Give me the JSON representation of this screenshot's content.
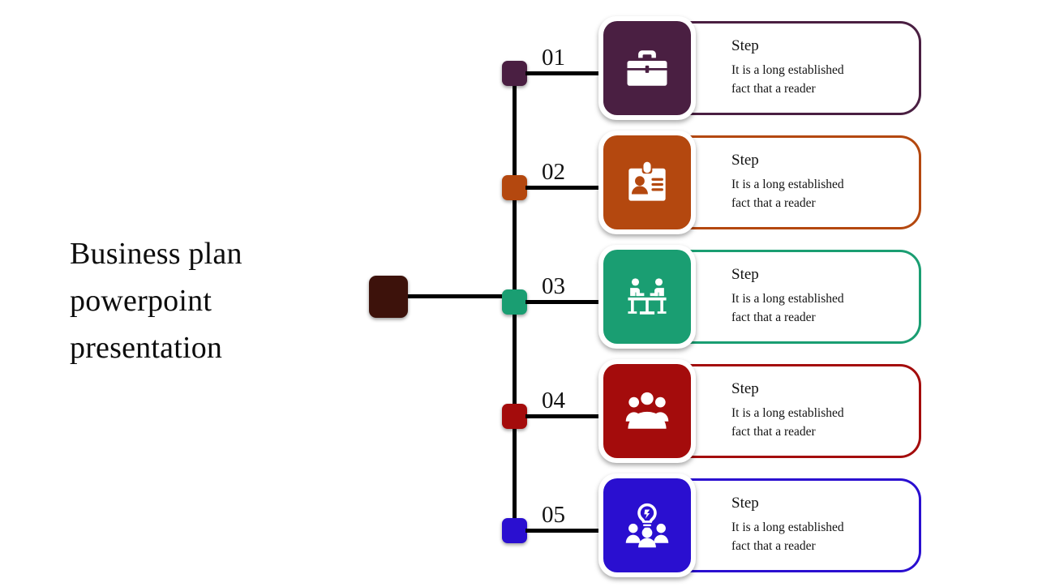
{
  "slide": {
    "title": "Business plan powerpoint presentation",
    "title_lines": [
      "Business plan",
      "powerpoint",
      "presentation"
    ],
    "background_color": "#ffffff",
    "anchor_color": "#3d120b",
    "spine_color": "#000000"
  },
  "steps": [
    {
      "number": "01",
      "title": "Step",
      "body_lines": [
        "It is a long established",
        "fact that a reader"
      ],
      "body": "It is a long established fact that a reader",
      "color": "#4a1f42",
      "icon": "briefcase-icon"
    },
    {
      "number": "02",
      "title": "Step",
      "body_lines": [
        "It is a long established",
        "fact that a reader"
      ],
      "body": "It is a long established fact that a reader",
      "color": "#b4480f",
      "icon": "id-badge-icon"
    },
    {
      "number": "03",
      "title": "Step",
      "body_lines": [
        "It is a long established",
        "fact that a reader"
      ],
      "body": "It is a long established fact that a reader",
      "color": "#1a9e72",
      "icon": "meeting-table-icon"
    },
    {
      "number": "04",
      "title": "Step",
      "body_lines": [
        "It is a long established",
        "fact that a reader"
      ],
      "body": "It is a long established fact that a reader",
      "color": "#a40c0c",
      "icon": "team-group-icon"
    },
    {
      "number": "05",
      "title": "Step",
      "body_lines": [
        "It is a long established",
        "fact that a reader"
      ],
      "body": "It is a long established fact that a reader",
      "color": "#2a0fd0",
      "icon": "team-idea-bulb-icon"
    }
  ]
}
